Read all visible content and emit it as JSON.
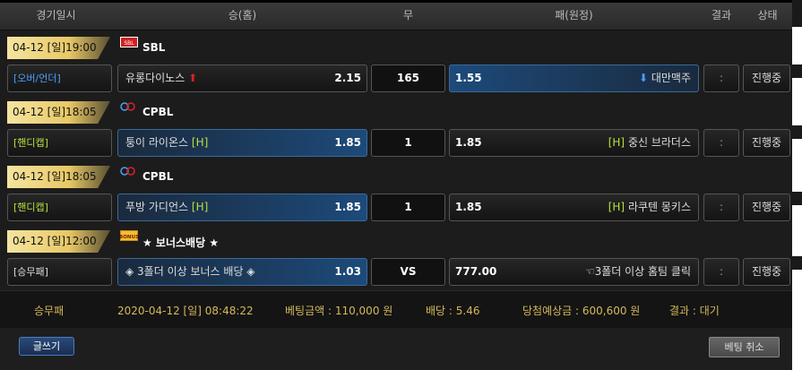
{
  "header": {
    "col_datetime": "경기일시",
    "col_home": "승(홈)",
    "col_draw": "무",
    "col_away": "패(원정)",
    "col_result": "결과",
    "col_status": "상태"
  },
  "games": [
    {
      "datetime": "04-12 [일]19:00",
      "league": "SBL",
      "league_icon": "sbl-logo-icon",
      "bet_type": "[오버/언더]",
      "home_team": "유롱다이노스",
      "home_mark": "⬆",
      "home_odds": "2.15",
      "draw": "165",
      "away_odds": "1.55",
      "away_mark": "⬇",
      "away_team": "대만맥주",
      "result": ":",
      "status": "진행중",
      "selected": "away"
    },
    {
      "datetime": "04-12 [일]18:05",
      "league": "CPBL",
      "league_icon": "cpbl-logo-icon",
      "bet_type": "[핸디캡]",
      "home_team": "퉁이 라이온스",
      "home_mark": "[H]",
      "home_odds": "1.85",
      "draw": "1",
      "away_odds": "1.85",
      "away_mark": "[H]",
      "away_team": "중신 브라더스",
      "result": ":",
      "status": "진행중",
      "selected": "home"
    },
    {
      "datetime": "04-12 [일]18:05",
      "league": "CPBL",
      "league_icon": "cpbl-logo-icon",
      "bet_type": "[핸디캡]",
      "home_team": "푸방 가디언스",
      "home_mark": "[H]",
      "home_odds": "1.85",
      "draw": "1",
      "away_odds": "1.85",
      "away_mark": "[H]",
      "away_team": "라쿠텐 몽키스",
      "result": ":",
      "status": "진행중",
      "selected": "home"
    },
    {
      "datetime": "04-12 [일]12:00",
      "league": "★ 보너스배당 ★",
      "league_icon": "bonus-icon",
      "bet_type": "[승무패]",
      "home_team": "◈ 3폴더 이상 보너스 배당 ◈",
      "home_mark": "",
      "home_odds": "1.03",
      "draw": "VS",
      "away_odds": "777.00",
      "away_mark": "☜",
      "away_team": "3폴더 이상 홈팀 클릭",
      "result": ":",
      "status": "진행중",
      "selected": "home"
    }
  ],
  "summary": {
    "bet_type": "승무패",
    "bet_time": "2020-04-12 [일] 08:48:22",
    "bet_amount": "베팅금액 : 110,000 원",
    "odds": "배당 : 5.46",
    "expected_win": "당첨예상금 : 600,600 원",
    "result": "결과 : 대기"
  },
  "footer": {
    "write_button": "글쓰기",
    "cancel_button": "베팅 취소"
  },
  "colors": {
    "accent_gold": "#e8c866",
    "selected_blue": "#1d4a7a",
    "handicap_green": "#b8e040",
    "overunder_blue": "#4aa0ff"
  }
}
